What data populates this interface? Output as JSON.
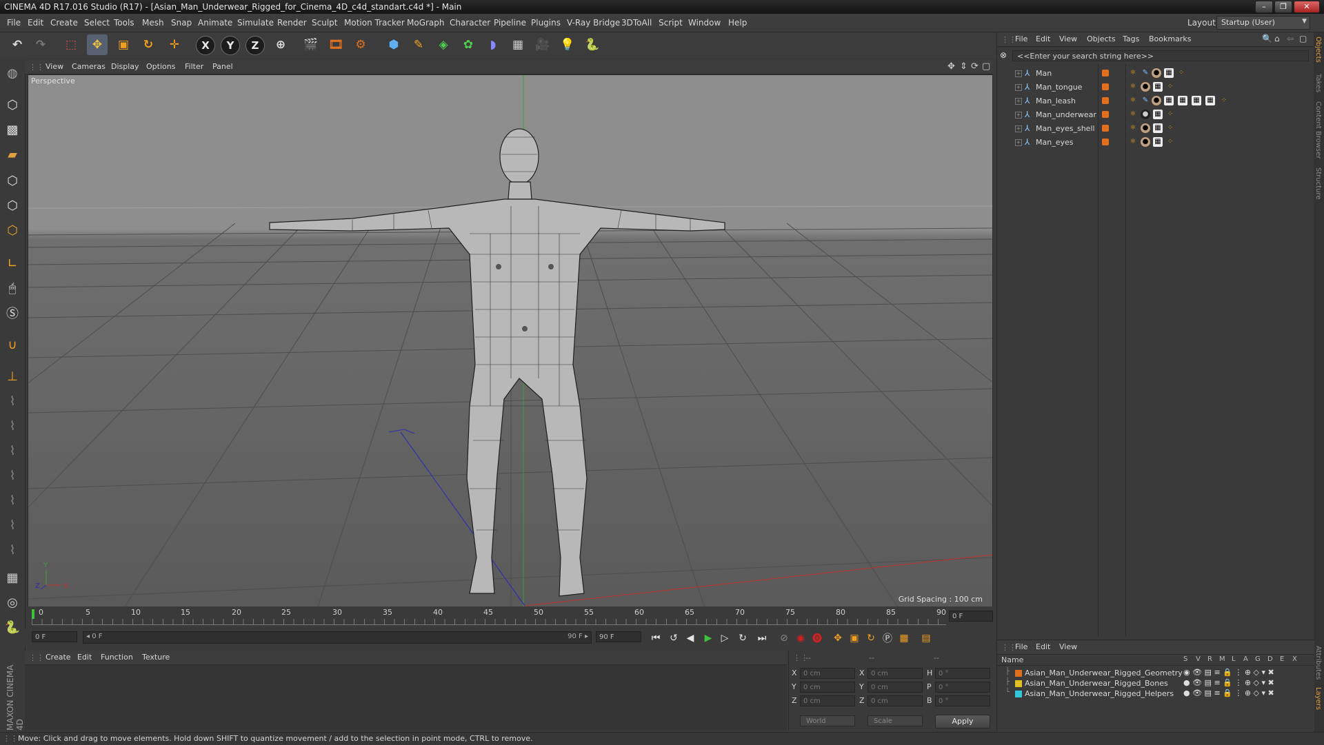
{
  "window": {
    "title": "CINEMA 4D R17.016 Studio (R17) - [Asian_Man_Underwear_Rigged_for_Cinema_4D_c4d_standart.c4d *] - Main",
    "controls": [
      "–",
      "❐",
      "✕"
    ]
  },
  "menubar": {
    "items": [
      "File",
      "Edit",
      "Create",
      "Select",
      "Tools",
      "Mesh",
      "Snap",
      "Animate",
      "Simulate",
      "Render",
      "Sculpt",
      "Motion Tracker",
      "MoGraph",
      "Character",
      "Pipeline",
      "Plugins",
      "V-Ray Bridge",
      "3DToAll",
      "Script",
      "Window",
      "Help"
    ],
    "layout_label": "Layout:",
    "layout_value": "Startup (User)"
  },
  "toolbar": {
    "axis_x": "X",
    "axis_y": "Y",
    "axis_z": "Z"
  },
  "viewport": {
    "menu": [
      "View",
      "Cameras",
      "Display",
      "Options",
      "Filter",
      "Panel"
    ],
    "label": "Perspective",
    "grid_spacing": "Grid Spacing : 100 cm",
    "axis_labels": {
      "y": "Y",
      "x": "X",
      "z": "Z"
    }
  },
  "timeline": {
    "ticks": [
      "0",
      "5",
      "10",
      "15",
      "20",
      "25",
      "30",
      "35",
      "40",
      "45",
      "50",
      "55",
      "60",
      "65",
      "70",
      "75",
      "80",
      "85",
      "90"
    ],
    "current_frame_right": "0 F",
    "start_field": "0 F",
    "range_start": "◂ 0 F",
    "range_end": "90 F ▸",
    "end_field": "90 F",
    "end_field2": "90 F"
  },
  "material_panel": {
    "menu": [
      "Create",
      "Edit",
      "Function",
      "Texture"
    ]
  },
  "coordinates": {
    "headers": [
      "--",
      "--",
      "--"
    ],
    "rows": [
      {
        "l1": "X",
        "v1": "0 cm",
        "l2": "X",
        "v2": "0 cm",
        "l3": "H",
        "v3": "0 °"
      },
      {
        "l1": "Y",
        "v1": "0 cm",
        "l2": "Y",
        "v2": "0 cm",
        "l3": "P",
        "v3": "0 °"
      },
      {
        "l1": "Z",
        "v1": "0 cm",
        "l2": "Z",
        "v2": "0 cm",
        "l3": "B",
        "v3": "0 °"
      }
    ],
    "mode_dropdown": "World",
    "scale_dropdown": "Scale",
    "apply_label": "Apply"
  },
  "object_manager": {
    "menu": [
      "File",
      "Edit",
      "View",
      "Objects",
      "Tags",
      "Bookmarks"
    ],
    "search_placeholder": "<<Enter your search string here>>",
    "objects": [
      {
        "name": "Man",
        "tags": 6
      },
      {
        "name": "Man_tongue",
        "tags": 4
      },
      {
        "name": "Man_leash",
        "tags": 9
      },
      {
        "name": "Man_underwear",
        "tags": 4
      },
      {
        "name": "Man_eyes_shell",
        "tags": 4
      },
      {
        "name": "Man_eyes",
        "tags": 4
      }
    ]
  },
  "layer_manager": {
    "menu": [
      "File",
      "Edit",
      "View"
    ],
    "name_header": "Name",
    "columns": [
      "S",
      "V",
      "R",
      "M",
      "L",
      "A",
      "G",
      "D",
      "E",
      "X"
    ],
    "layers": [
      {
        "name": "Asian_Man_Underwear_Rigged_Geometry",
        "color": "#e07020"
      },
      {
        "name": "Asian_Man_Underwear_Rigged_Bones",
        "color": "#e0c020"
      },
      {
        "name": "Asian_Man_Underwear_Rigged_Helpers",
        "color": "#30c8d8"
      }
    ]
  },
  "side_tabs": [
    "Objects",
    "Takes",
    "Content Browser",
    "Structure",
    "Attributes",
    "Layers"
  ],
  "status": {
    "text": "Move: Click and drag to move elements. Hold down SHIFT to quantize movement / add to the selection in point mode, CTRL to remove."
  },
  "brand": {
    "logo_text": "MAXON CINEMA 4D"
  },
  "colors": {
    "accent_orange": "#e07020",
    "play_green": "#3fc13f",
    "record_red": "#d02020"
  }
}
